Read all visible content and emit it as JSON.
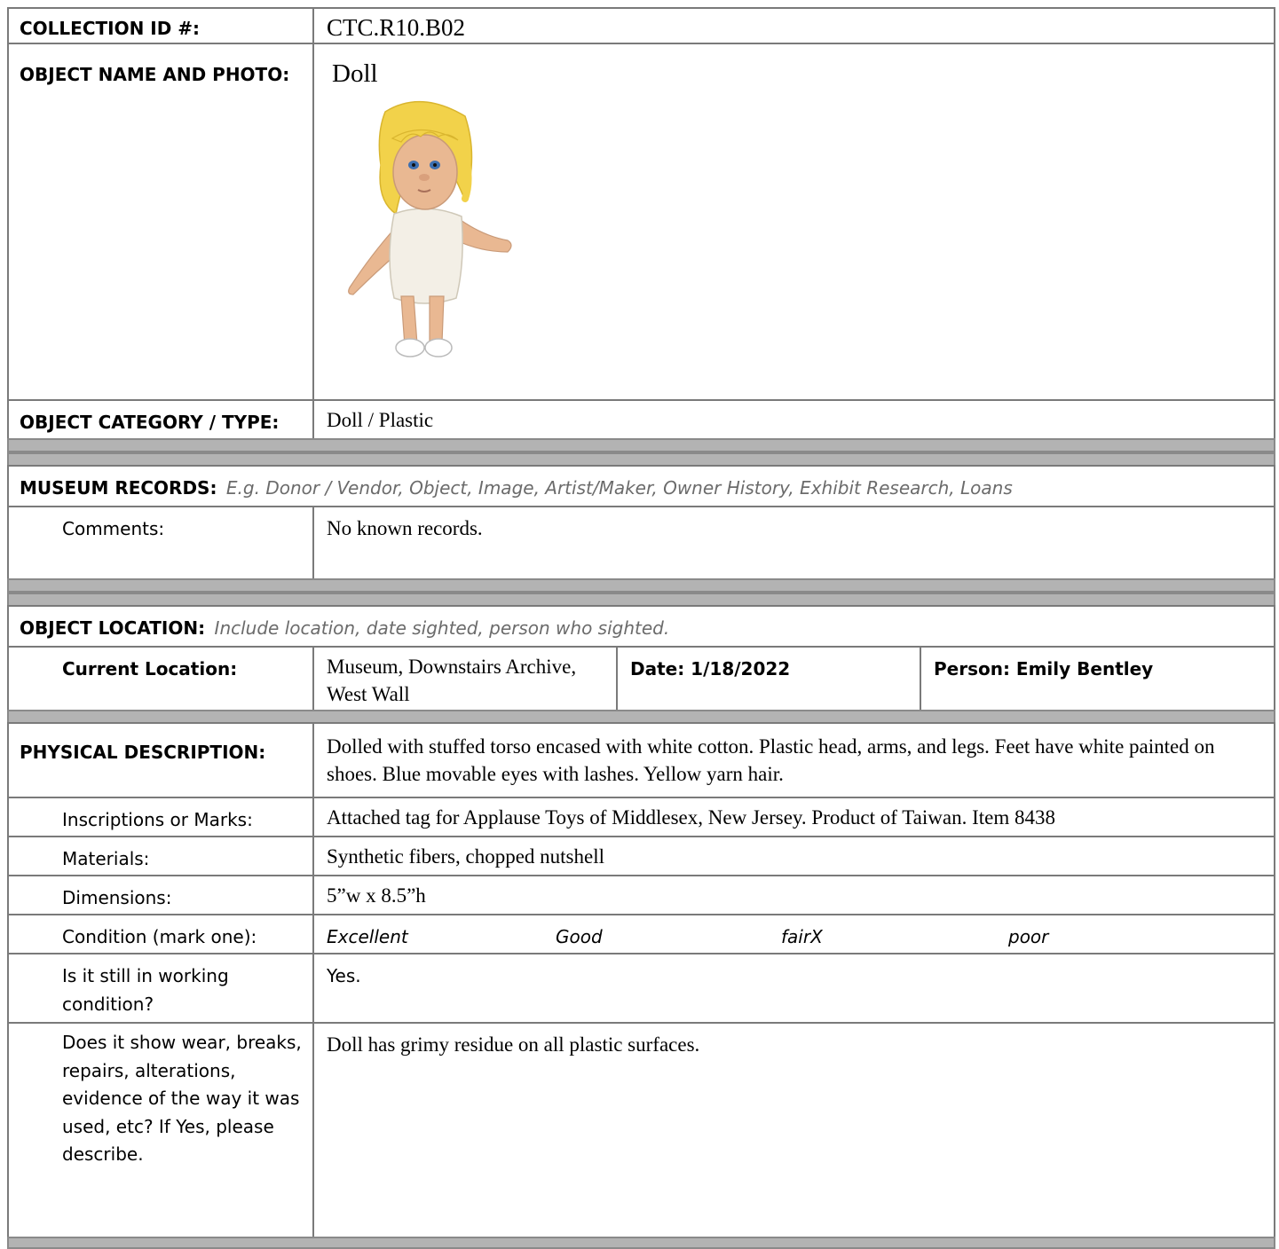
{
  "collection": {
    "label": "COLLECTION ID #:",
    "value": "CTC.R10.B02"
  },
  "object": {
    "label": "OBJECT NAME AND PHOTO:",
    "name": "Doll"
  },
  "category": {
    "label": "OBJECT CATEGORY / TYPE:",
    "value": "Doll / Plastic"
  },
  "records": {
    "label": "MUSEUM RECORDS:",
    "hint": "E.g. Donor / Vendor, Object, Image, Artist/Maker, Owner History, Exhibit Research, Loans",
    "comments_label": "Comments:",
    "comments_value": "No known records."
  },
  "location": {
    "label": "OBJECT LOCATION:",
    "hint": "Include location, date sighted, person who sighted.",
    "current_label": "Current Location:",
    "current_value": "Museum, Downstairs Archive, West Wall",
    "date": "Date: 1/18/2022",
    "person": "Person: Emily Bentley"
  },
  "physical": {
    "label": "PHYSICAL DESCRIPTION:",
    "value": "Dolled with stuffed torso encased with white cotton. Plastic head, arms, and legs. Feet have white painted on shoes. Blue movable eyes with lashes. Yellow yarn hair.",
    "inscriptions_label": "Inscriptions or Marks:",
    "inscriptions_value": "Attached tag for Applause Toys of Middlesex, New Jersey. Product of Taiwan. Item 8438",
    "materials_label": "Materials:",
    "materials_value": "Synthetic fibers, chopped nutshell",
    "dimensions_label": "Dimensions:",
    "dimensions_value": "5”w x 8.5”h",
    "condition_label": "Condition (mark one):",
    "condition_options": [
      "Excellent",
      "Good",
      "fairX",
      "poor"
    ],
    "working_label": "Is it still in working condition?",
    "working_value": "Yes.",
    "wear_label": "Does it show wear, breaks, repairs, alterations, evidence of the way it was used, etc? If Yes, please describe.",
    "wear_value": "Doll has grimy residue on all plastic surfaces."
  },
  "colors": {
    "border": "#7a7a7a",
    "band": "#b3b3b3",
    "hint": "#6b6b6b",
    "hair": "#f2d24a",
    "skin": "#e9b892",
    "outfit": "#f3efe6"
  }
}
